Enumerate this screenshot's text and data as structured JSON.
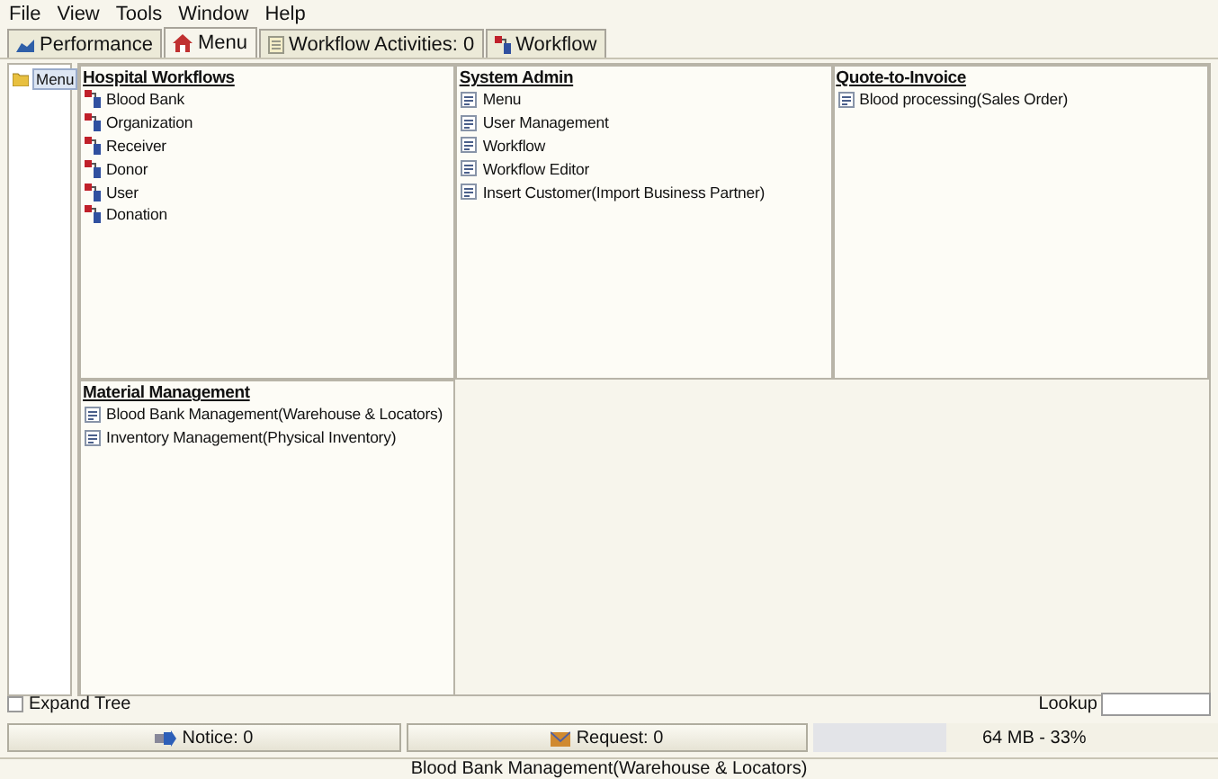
{
  "menubar": [
    "File",
    "View",
    "Tools",
    "Window",
    "Help"
  ],
  "tabs": [
    {
      "label": "Performance",
      "kind": "chart",
      "selected": false
    },
    {
      "label": "Menu",
      "kind": "home",
      "selected": true
    },
    {
      "label": "Workflow Activities: 0",
      "kind": "list",
      "selected": false
    },
    {
      "label": "Workflow",
      "kind": "workflow",
      "selected": false
    }
  ],
  "tree": {
    "label": "Menu",
    "selected": true
  },
  "panels": [
    {
      "title": "Hospital Workflows",
      "items": [
        {
          "label": "Blood Bank",
          "kind": "workflow"
        },
        {
          "label": "Organization",
          "kind": "workflow"
        },
        {
          "label": "Receiver",
          "kind": "workflow"
        },
        {
          "label": "Donor",
          "kind": "workflow"
        },
        {
          "label": "User",
          "kind": "workflow"
        },
        {
          "label": "Donation",
          "kind": "workflow"
        }
      ]
    },
    {
      "title": "System Admin",
      "items": [
        {
          "label": "Menu",
          "kind": "window"
        },
        {
          "label": "User Management",
          "kind": "window"
        },
        {
          "label": "Workflow",
          "kind": "window"
        },
        {
          "label": "Workflow Editor",
          "kind": "window"
        },
        {
          "label": "Insert Customer(Import Business Partner)",
          "kind": "window"
        }
      ]
    },
    {
      "title": "Quote-to-Invoice",
      "items": [
        {
          "label": "Blood processing(Sales Order)",
          "kind": "window"
        }
      ]
    },
    {
      "title": "Material Management",
      "items": [
        {
          "label": "Blood Bank Management(Warehouse & Locators)",
          "kind": "window"
        },
        {
          "label": "Inventory Management(Physical Inventory)",
          "kind": "window"
        }
      ]
    }
  ],
  "expand_tree": {
    "label": "Expand Tree",
    "checked": false
  },
  "lookup": {
    "label": "Lookup"
  },
  "status": {
    "notice": "Notice: 0",
    "request": "Request: 0",
    "memory": {
      "level": 0.33,
      "reading": "64 MB - 33%"
    }
  },
  "footer": "Blood Bank Management(Warehouse & Locators)"
}
